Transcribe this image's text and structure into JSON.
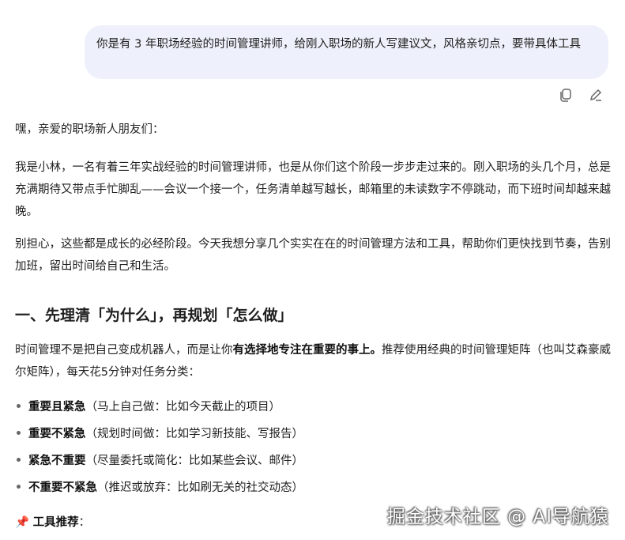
{
  "user_message": "你是有 3 年职场经验的时间管理讲师，给刚入职场的新人写建议文，风格亲切点，要带具体工具",
  "message_actions": {
    "copy": "copy-icon",
    "edit": "edit-icon"
  },
  "response": {
    "greeting": "嘿，亲爱的职场新人朋友们：",
    "para1": "我是小林，一名有着三年实战经验的时间管理讲师，也是从你们这个阶段一步步走过来的。刚入职场的头几个月，总是充满期待又带点手忙脚乱——会议一个接一个，任务清单越写越长，邮箱里的未读数字不停跳动，而下班时间却越来越晚。",
    "para2": "别担心，这些都是成长的必经阶段。今天我想分享几个实实在在的时间管理方法和工具，帮助你们更快找到节奏，告别加班，留出时间给自己和生活。",
    "heading1": "一、先理清「为什么」，再规划「怎么做」",
    "para3_a": "时间管理不是把自己变成机器人，而是让你",
    "para3_bold": "有选择地专注在重要的事上。",
    "para3_b": "推荐使用经典的时间管理矩阵（也叫艾森豪威尔矩阵），每天花5分钟对任务分类：",
    "bullets": [
      {
        "bold": "重要且紧急",
        "text": "（马上自己做：比如今天截止的项目）"
      },
      {
        "bold": "重要不紧急",
        "text": "（规划时间做：比如学习新技能、写报告）"
      },
      {
        "bold": "紧急不重要",
        "text": "（尽量委托或简化：比如某些会议、邮件）"
      },
      {
        "bold": "不重要不紧急",
        "text": "（推迟或放弃：比如刷无关的社交动态）"
      }
    ],
    "tools_icon": "📌",
    "tools_label": "工具推荐",
    "tools_colon": "："
  },
  "watermark": "掘金技术社区 @ AI导航猿"
}
